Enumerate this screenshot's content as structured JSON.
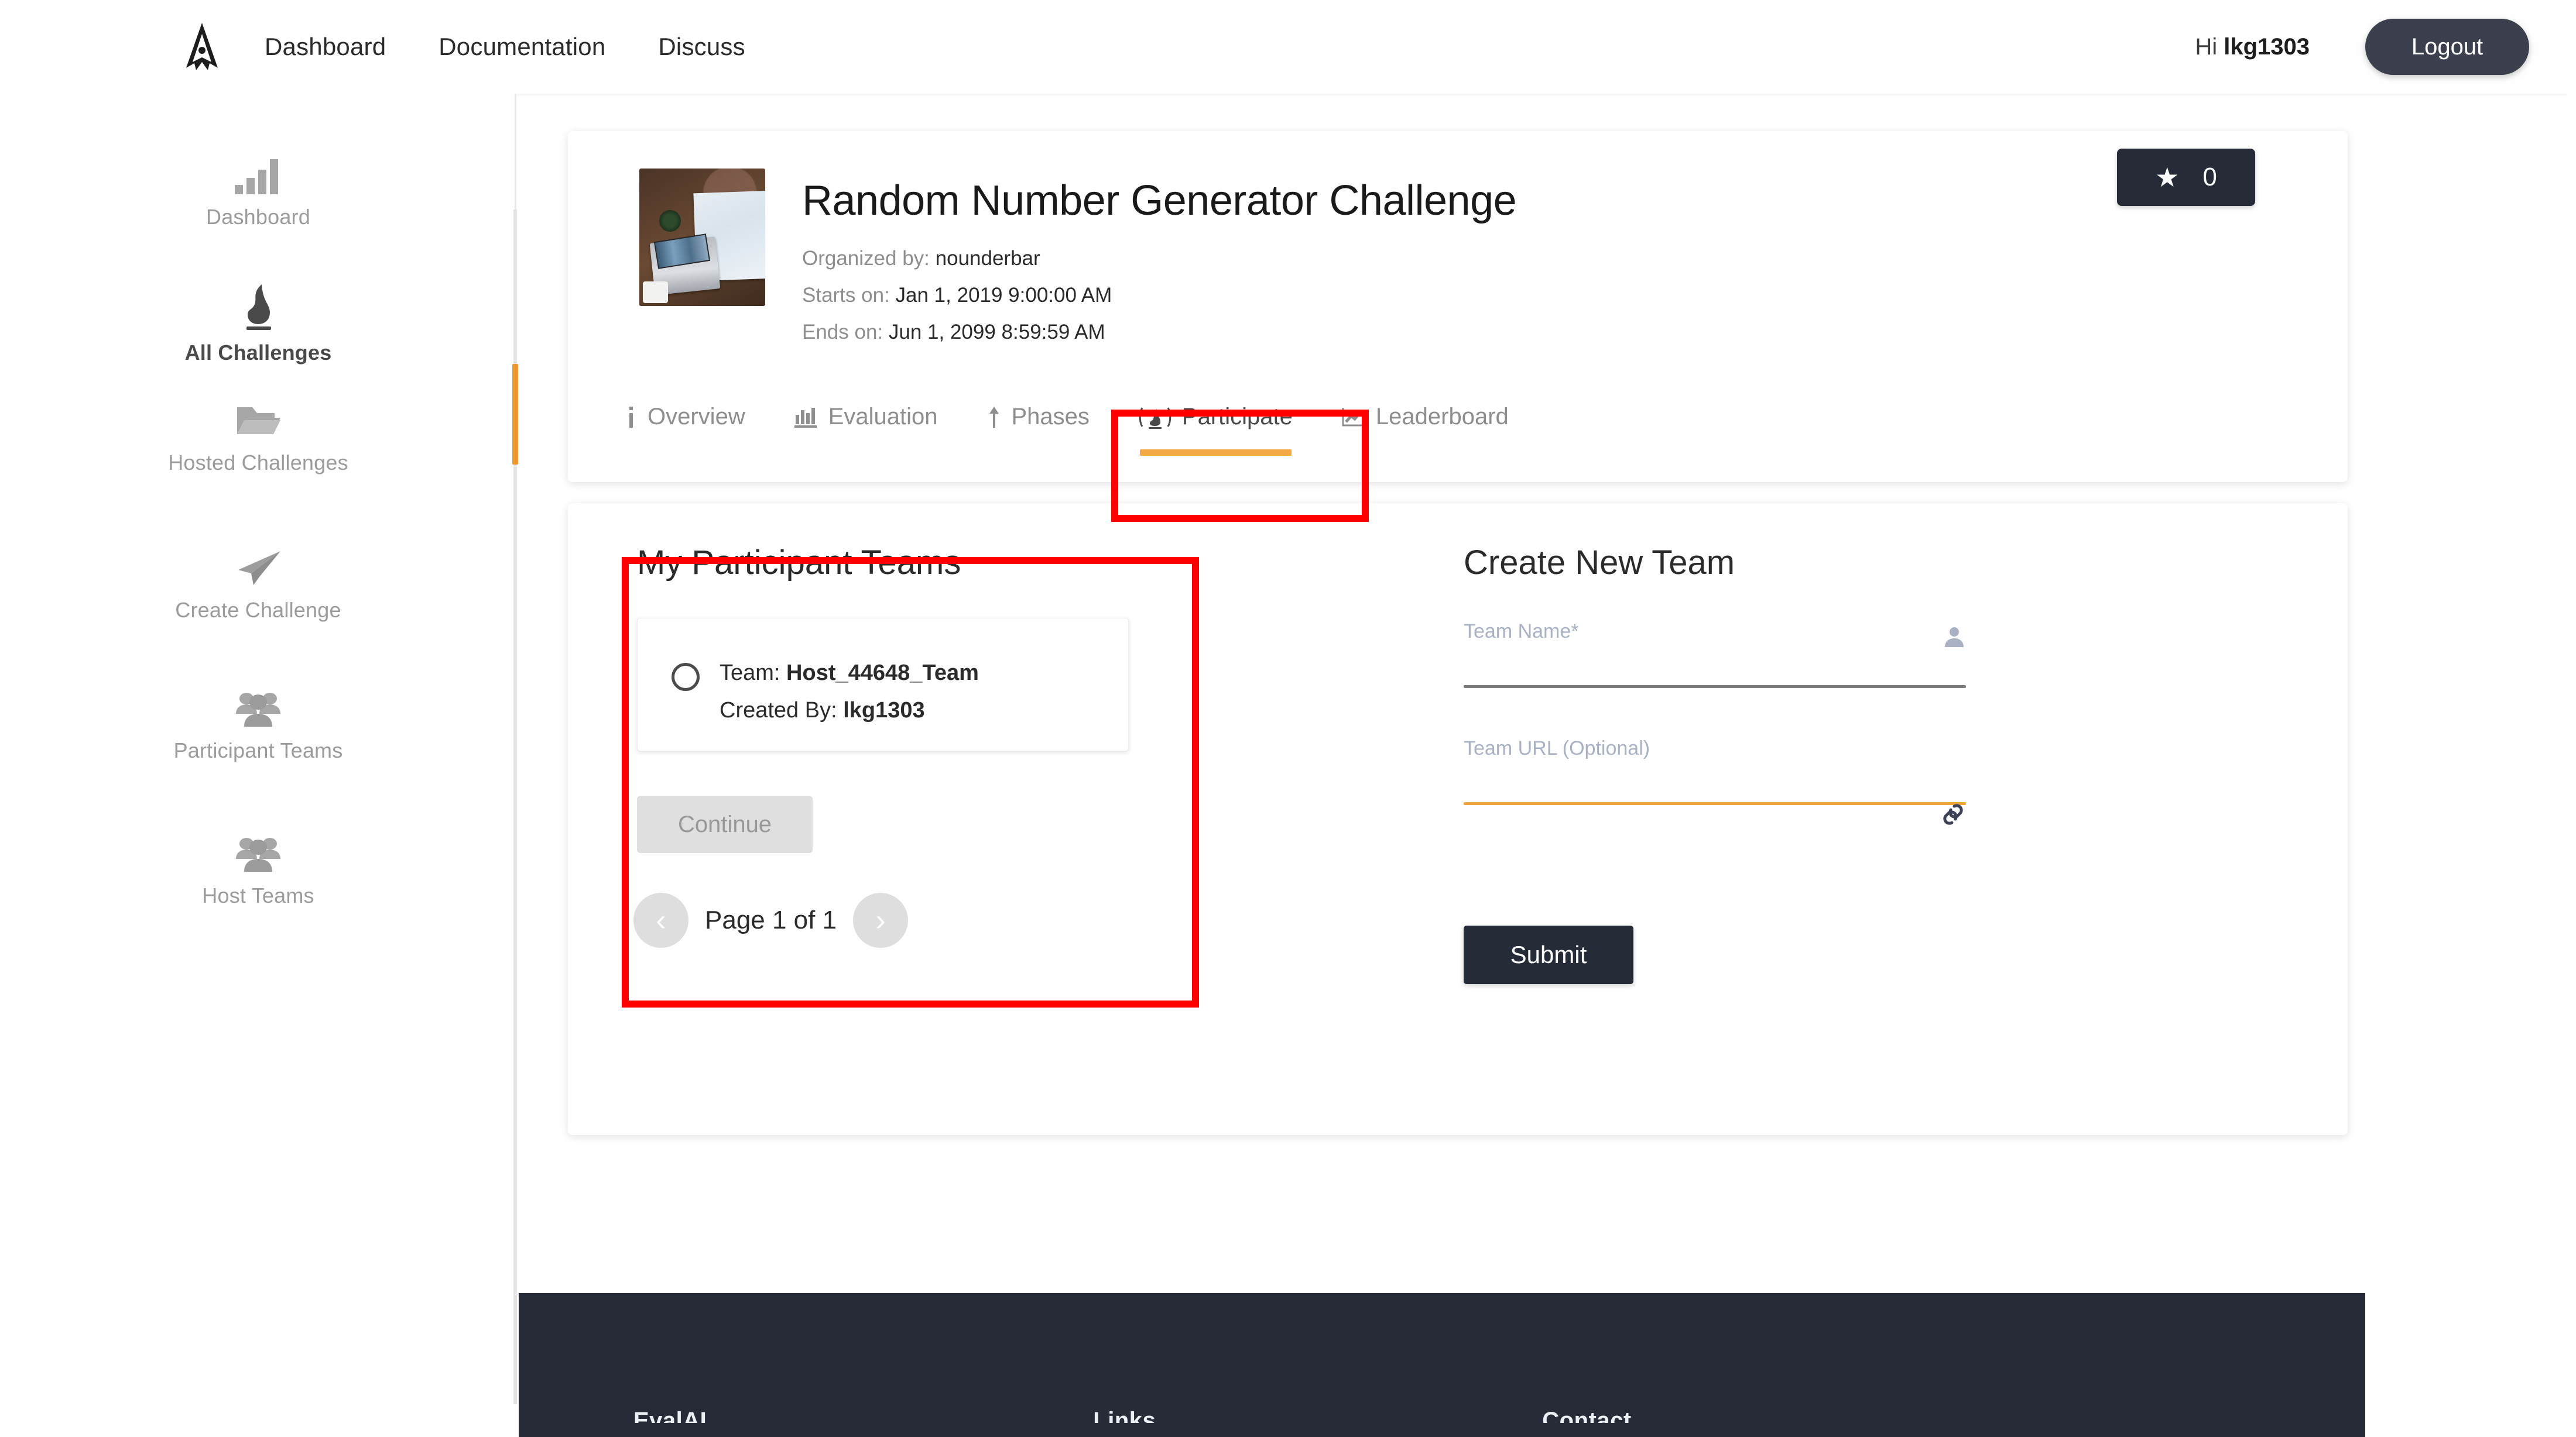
{
  "topbar": {
    "logo_icon": "evalai-rocket-logo",
    "nav": [
      {
        "label": "Dashboard"
      },
      {
        "label": "Documentation"
      },
      {
        "label": "Discuss"
      }
    ],
    "greeting_prefix": "Hi ",
    "username": "lkg1303",
    "logout_label": "Logout"
  },
  "sidebar": {
    "items": [
      {
        "label": "Dashboard",
        "icon": "bar-chart-icon",
        "active": false
      },
      {
        "label": "All Challenges",
        "icon": "flame-icon",
        "active": true
      },
      {
        "label": "Hosted Challenges",
        "icon": "folder-icon",
        "active": false
      },
      {
        "label": "Create Challenge",
        "icon": "paper-plane-icon",
        "active": false
      },
      {
        "label": "Participant Teams",
        "icon": "people-group-icon",
        "active": false
      },
      {
        "label": "Host Teams",
        "icon": "people-group-icon",
        "active": false
      }
    ]
  },
  "challenge": {
    "thumbnail_icon": "challenge-banner-image",
    "title": "Random Number Generator Challenge",
    "organized_by_label": "Organized by:",
    "organized_by_value": "nounderbar",
    "starts_on_label": "Starts on:",
    "starts_on_value": "Jan 1, 2019 9:00:00 AM",
    "ends_on_label": "Ends on:",
    "ends_on_value": "Jun 1, 2099 8:59:59 AM",
    "star_icon": "star-icon",
    "star_count": "0"
  },
  "tabs": [
    {
      "label": "Overview",
      "icon": "info-icon",
      "glyph": "ℹ",
      "active": false
    },
    {
      "label": "Evaluation",
      "icon": "bar-chart-icon",
      "glyph": "█",
      "active": false
    },
    {
      "label": "Phases",
      "icon": "arrow-up-icon",
      "glyph": "⤴",
      "active": false
    },
    {
      "label": "Participate",
      "icon": "flame-icon",
      "glyph": "(ф)",
      "active": true
    },
    {
      "label": "Leaderboard",
      "icon": "trend-up-icon",
      "glyph": "↗",
      "active": false
    }
  ],
  "participate": {
    "my_teams_title": "My Participant Teams",
    "teams": [
      {
        "team_label": "Team:",
        "team_name": "Host_44648_Team",
        "created_by_label": "Created By:",
        "created_by_value": "lkg1303",
        "selected": false
      }
    ],
    "continue_label": "Continue",
    "pagination": {
      "prev_icon": "chevron-left-icon",
      "next_icon": "chevron-right-icon",
      "text": "Page 1 of 1"
    },
    "create_team": {
      "title": "Create New Team",
      "team_name_label": "Team Name*",
      "team_name_value": "",
      "team_name_icon": "user-icon",
      "team_url_label": "Team URL (Optional)",
      "team_url_value": "",
      "team_url_icon": "link-icon",
      "submit_label": "Submit"
    }
  },
  "footer": {
    "columns": [
      {
        "title": "EvalAI"
      },
      {
        "title": "Links"
      },
      {
        "title": "Contact"
      }
    ]
  },
  "colors": {
    "accent_orange": "#f5a846",
    "dark_navy": "#272b38",
    "highlight_red": "#fe0000",
    "muted_gray": "#9b9b9b",
    "field_label_blue": "#a9b1c4"
  }
}
